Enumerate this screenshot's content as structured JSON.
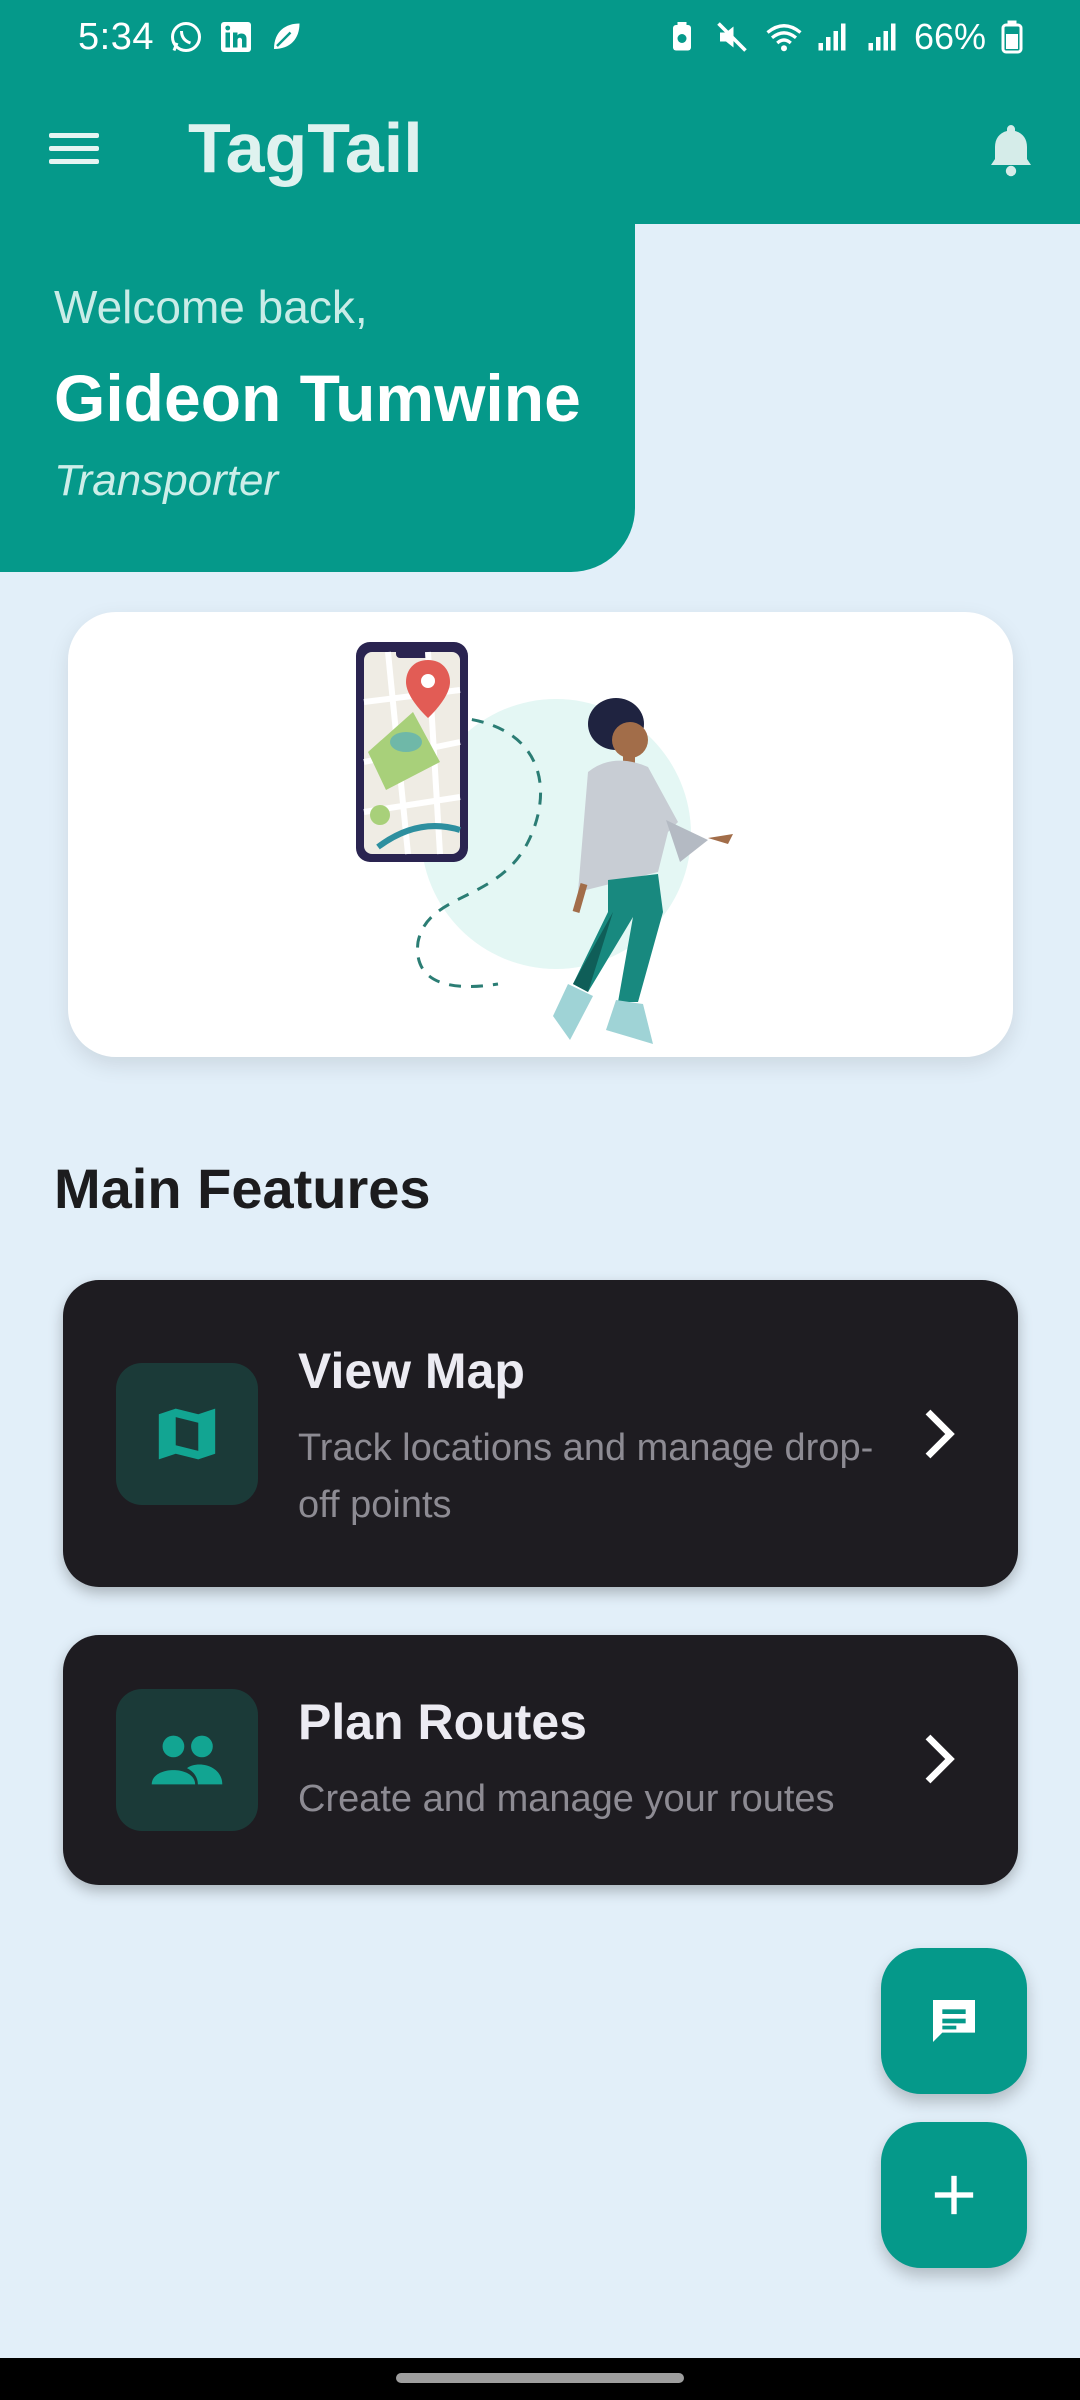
{
  "status_bar": {
    "time": "5:34",
    "battery": "66%",
    "left_icons": [
      "whatsapp-icon",
      "linkedin-icon",
      "leaf-icon"
    ],
    "right_icons": [
      "battery-saver-icon",
      "mute-icon",
      "wifi-icon",
      "signal-icon",
      "signal-icon",
      "battery-icon"
    ]
  },
  "app_bar": {
    "title": "TagTail",
    "menu_icon": "hamburger-menu-icon",
    "notification_icon": "bell-icon"
  },
  "welcome": {
    "greeting": "Welcome back,",
    "name": "Gideon Tumwine",
    "role": "Transporter"
  },
  "section": {
    "title": "Main Features"
  },
  "features": [
    {
      "title": "View Map",
      "description": "Track locations and manage drop-off points",
      "icon": "map-icon"
    },
    {
      "title": "Plan Routes",
      "description": "Create and manage your routes",
      "icon": "people-icon"
    }
  ],
  "fabs": {
    "chat_icon": "chat-icon",
    "add_icon": "plus-icon"
  },
  "colors": {
    "primary": "#05998a",
    "background": "#e2eff9",
    "card_dark": "#1e1c21",
    "icon_tile": "#1b3a38"
  }
}
